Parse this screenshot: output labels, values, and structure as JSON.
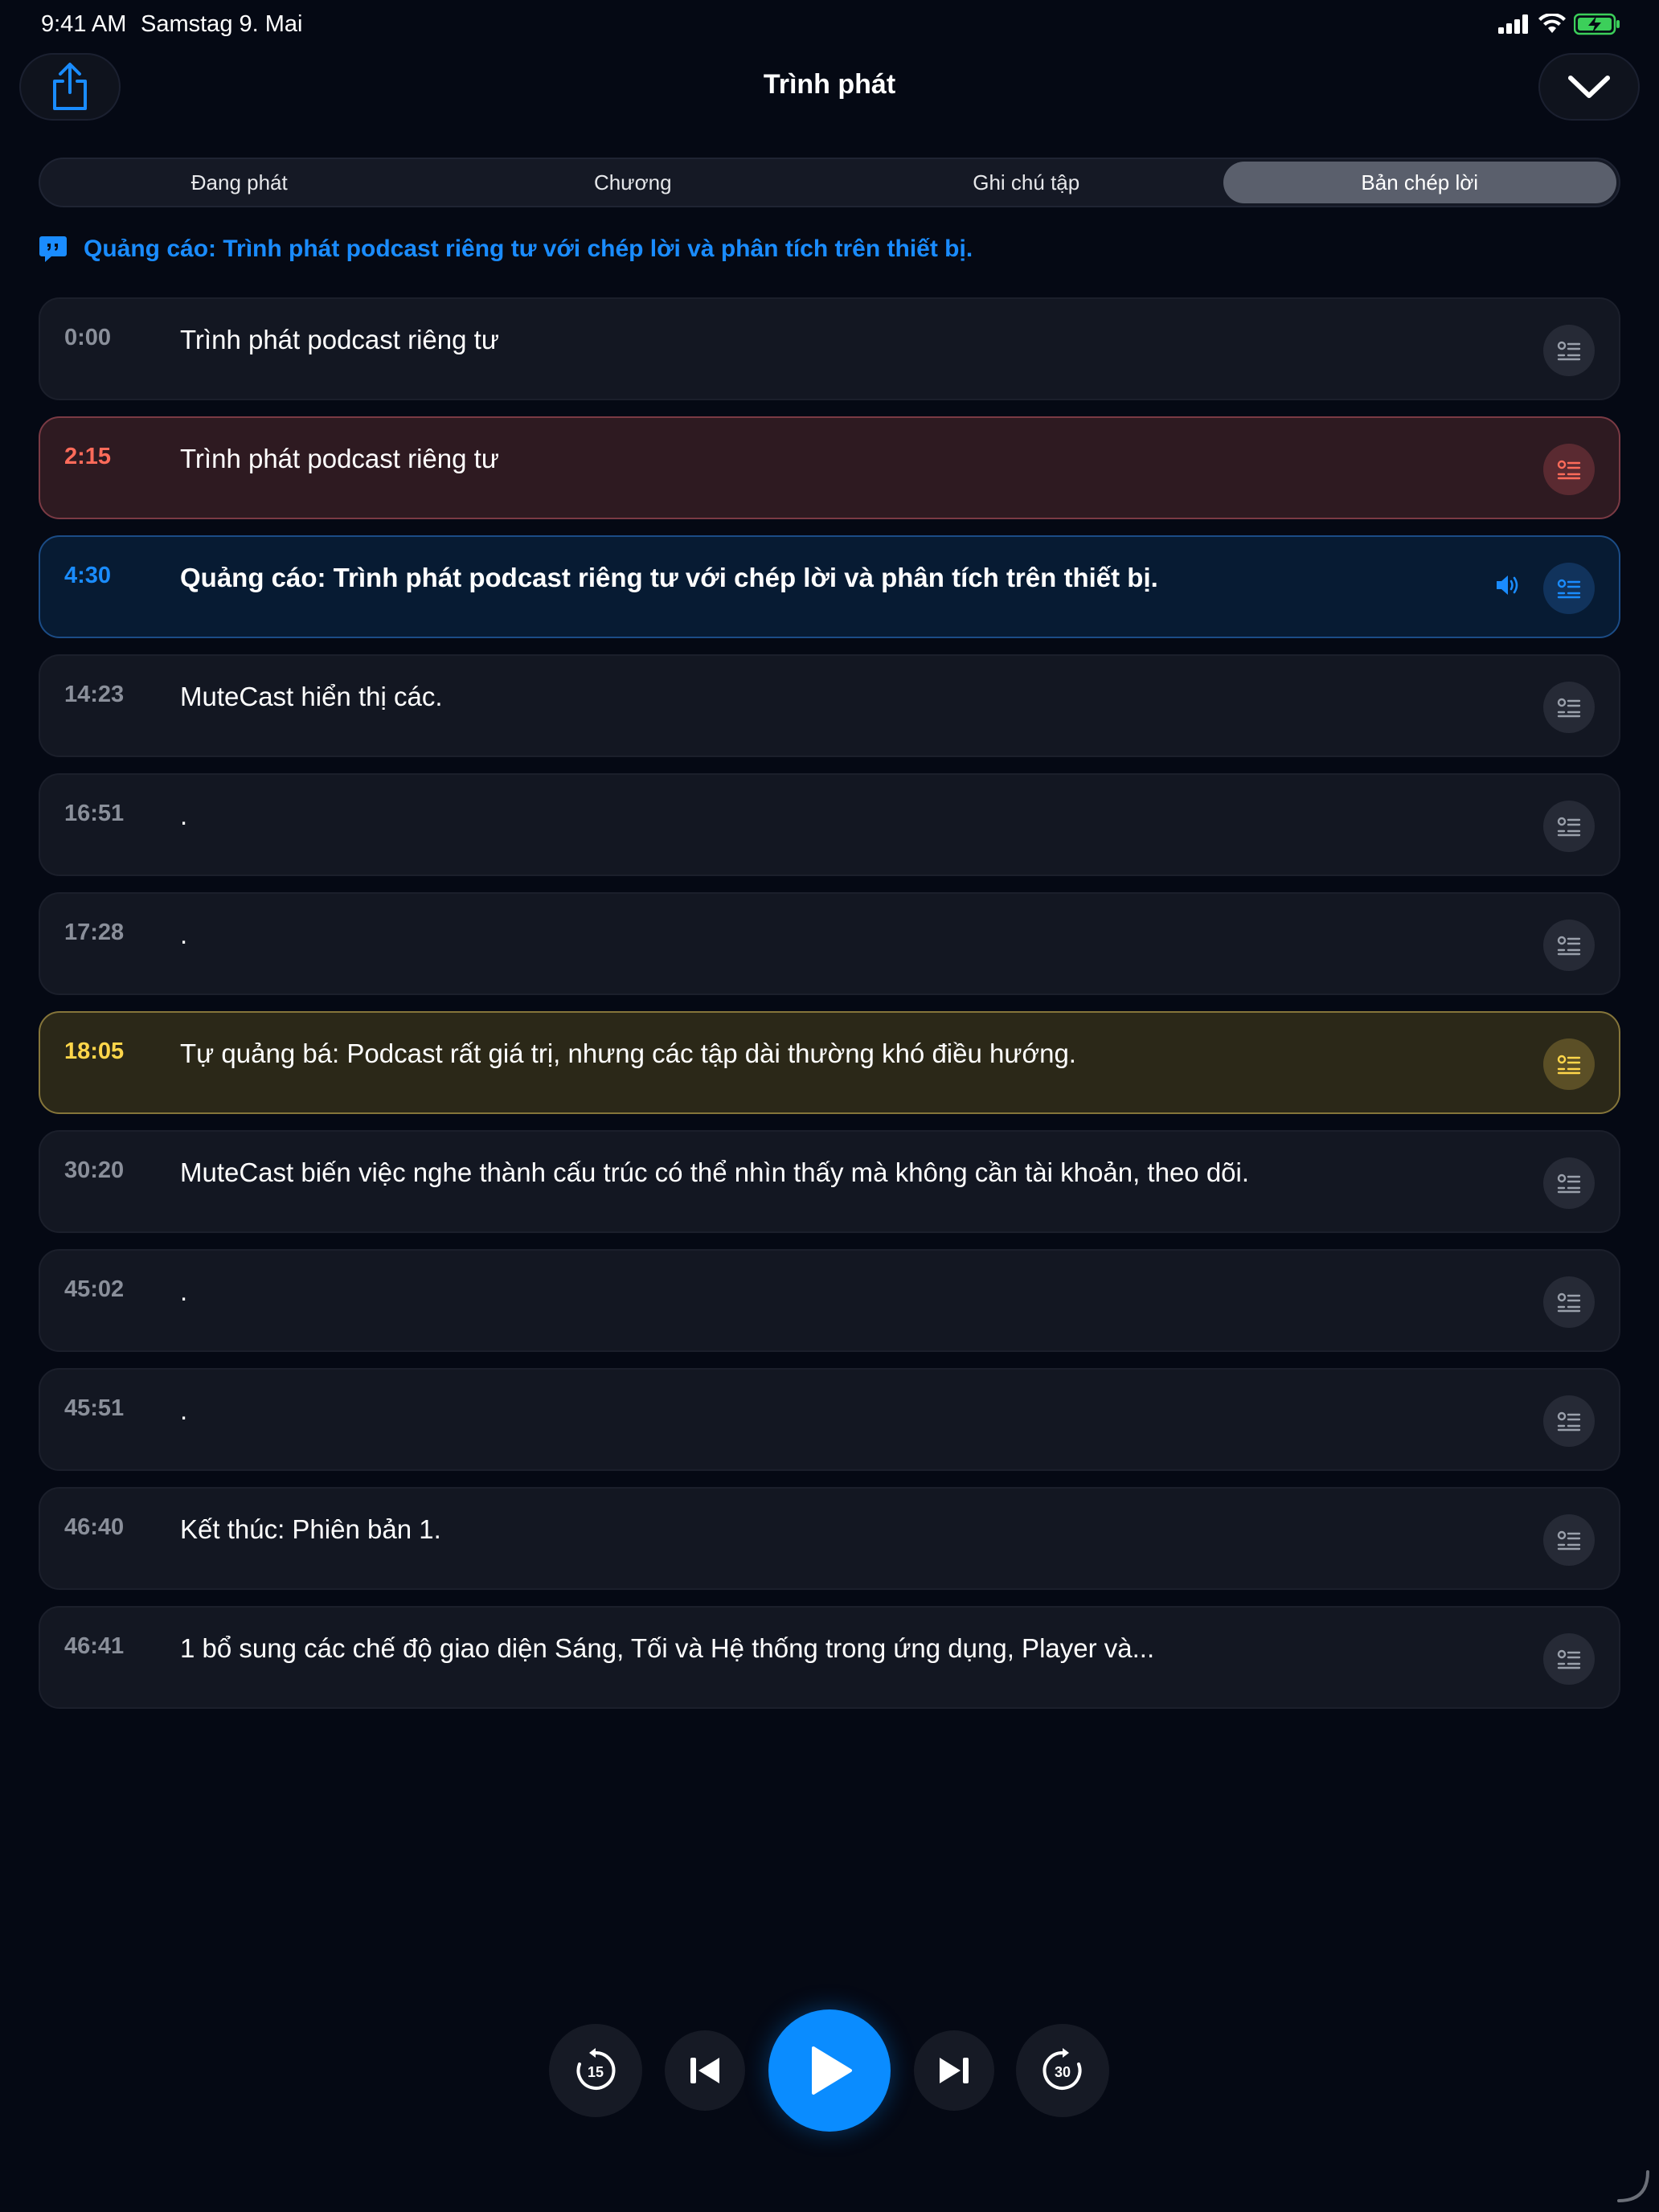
{
  "status_bar": {
    "time": "9:41 AM",
    "date": "Samstag 9. Mai"
  },
  "header": {
    "title": "Trình phát"
  },
  "tabs": [
    {
      "label": "Đang phát",
      "active": false
    },
    {
      "label": "Chương",
      "active": false
    },
    {
      "label": "Ghi chú tập",
      "active": false
    },
    {
      "label": "Bản chép lời",
      "active": true
    }
  ],
  "ad_banner": {
    "text": "Quảng cáo: Trình phát podcast riêng tư với chép lời và phân tích trên thiết bị.",
    "color": "#1a8cff"
  },
  "transcript": [
    {
      "time": "0:00",
      "text": "Trình phát podcast riêng tư",
      "highlight": "none"
    },
    {
      "time": "2:15",
      "text": "Trình phát podcast riêng tư",
      "highlight": "red"
    },
    {
      "time": "4:30",
      "text": "Quảng cáo: Trình phát podcast riêng tư với chép lời và phân tích trên thiết bị.",
      "highlight": "blue",
      "playing": true
    },
    {
      "time": "14:23",
      "text": "MuteCast hiển thị các.",
      "highlight": "none"
    },
    {
      "time": "16:51",
      "text": ".",
      "highlight": "none"
    },
    {
      "time": "17:28",
      "text": ".",
      "highlight": "none"
    },
    {
      "time": "18:05",
      "text": "Tự quảng bá: Podcast rất giá trị, nhưng các tập dài thường khó điều hướng.",
      "highlight": "yellow"
    },
    {
      "time": "30:20",
      "text": "MuteCast biến việc nghe thành cấu trúc có thể nhìn thấy mà không cần tài khoản, theo dõi.",
      "highlight": "none"
    },
    {
      "time": "45:02",
      "text": ".",
      "highlight": "none"
    },
    {
      "time": "45:51",
      "text": ".",
      "highlight": "none"
    },
    {
      "time": "46:40",
      "text": "Kết thúc: Phiên bản 1.",
      "highlight": "none"
    },
    {
      "time": "46:41",
      "text": "1 bổ sung các chế độ giao diện Sáng, Tối và Hệ thống trong ứng dụng, Player và...",
      "highlight": "none"
    }
  ],
  "controls": {
    "skip_back_seconds": "15",
    "skip_forward_seconds": "30"
  },
  "colors": {
    "accent": "#0a8cff",
    "background": "#050914",
    "highlight_red": "#ff6b5a",
    "highlight_blue": "#1a8cff",
    "highlight_yellow": "#ffd64a"
  }
}
